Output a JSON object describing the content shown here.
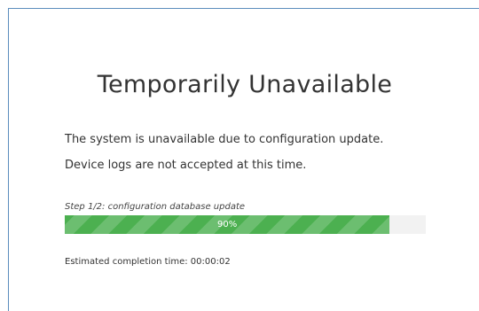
{
  "page": {
    "title": "Temporarily Unavailable",
    "message_line1": "The system is unavailable due to configuration update.",
    "message_line2": "Device logs are not accepted at this time."
  },
  "progress": {
    "step_label": "Step 1/2: configuration database update",
    "percent": 90,
    "percent_label": "90%",
    "bar_color": "#4cb050",
    "track_color": "#f2f2f2"
  },
  "estimate": {
    "label": "Estimated completion time: 00:00:02"
  },
  "colors": {
    "frame_border": "#5b8dbd"
  }
}
